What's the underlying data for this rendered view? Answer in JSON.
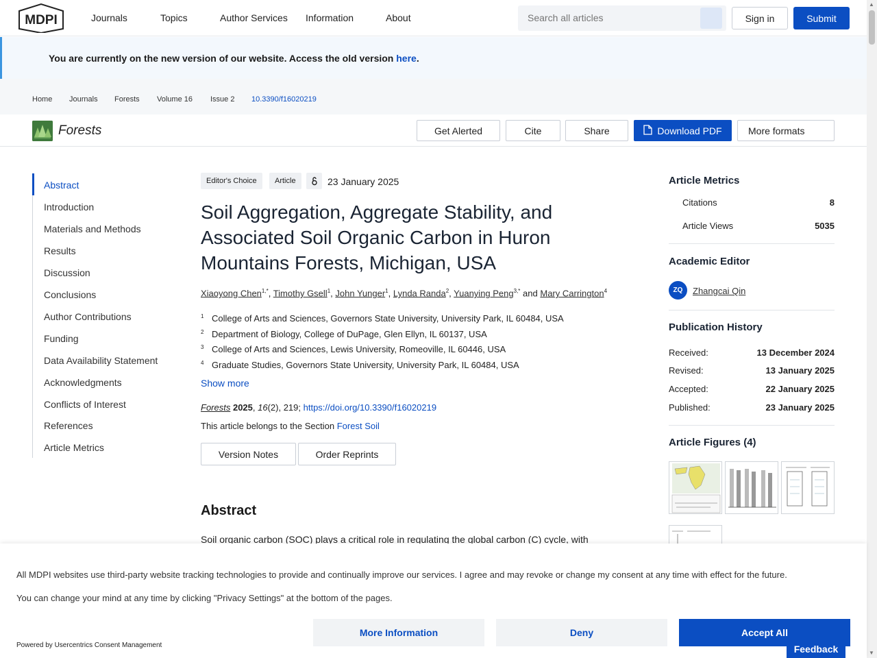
{
  "nav": {
    "logo_text": "MDPI",
    "items": [
      "Journals",
      "Topics",
      "Author Services",
      "Information",
      "About"
    ],
    "search_placeholder": "Search all articles",
    "signin": "Sign in",
    "submit": "Submit"
  },
  "banner": {
    "text": "You are currently on the new version of our website. Access the old version ",
    "link": "here",
    "tail": "."
  },
  "breadcrumb": [
    "Home",
    "Journals",
    "Forests",
    "Volume 16",
    "Issue 2",
    "10.3390/f16020219"
  ],
  "journal_bar": {
    "name": "Forests",
    "get_alerted": "Get Alerted",
    "cite": "Cite",
    "share": "Share",
    "download_pdf": "Download PDF",
    "more_formats": "More formats"
  },
  "toc": [
    "Abstract",
    "Introduction",
    "Materials and Methods",
    "Results",
    "Discussion",
    "Conclusions",
    "Author Contributions",
    "Funding",
    "Data Availability Statement",
    "Acknowledgments",
    "Conflicts of Interest",
    "References",
    "Article Metrics"
  ],
  "article": {
    "badges": [
      "Editor's Choice",
      "Article"
    ],
    "date": "23 January 2025",
    "title": "Soil Aggregation, Aggregate Stability, and Associated Soil Organic Carbon in Huron Mountains Forests, Michigan, USA",
    "authors": [
      {
        "name": "Xiaoyong Chen",
        "sup": "1,*"
      },
      {
        "name": "Timothy Gsell",
        "sup": "1"
      },
      {
        "name": "John Yunger",
        "sup": "1"
      },
      {
        "name": "Lynda Randa",
        "sup": "2"
      },
      {
        "name": "Yuanying Peng",
        "sup": "3,*"
      },
      {
        "name": "Mary Carrington",
        "sup": "4"
      }
    ],
    "and_word": "and",
    "affiliations": [
      {
        "num": "1",
        "text": "College of Arts and Sciences, Governors State University, University Park, IL 60484, USA"
      },
      {
        "num": "2",
        "text": "Department of Biology, College of DuPage, Glen Ellyn, IL 60137, USA"
      },
      {
        "num": "3",
        "text": "College of Arts and Sciences, Lewis University, Romeoville, IL 60446, USA"
      },
      {
        "num": "4",
        "text": "Graduate Studies, Governors State University, University Park, IL 60484, USA"
      }
    ],
    "show_more": "Show more",
    "citation": {
      "journal": "Forests",
      "year": "2025",
      "volume": "16",
      "issue_pages": "(2), 219; ",
      "doi": "https://doi.org/10.3390/f16020219"
    },
    "section_prefix": "This article belongs to the Section ",
    "section": "Forest Soil",
    "version_notes": "Version Notes",
    "order_reprints": "Order Reprints",
    "abstract_heading": "Abstract",
    "abstract_start": "Soil organic carbon (SOC) plays a critical role in regulating the global carbon (C) cycle, with"
  },
  "sidebar": {
    "metrics_heading": "Article Metrics",
    "citations_label": "Citations",
    "citations": "8",
    "views_label": "Article Views",
    "views": "5035",
    "editor_heading": "Academic Editor",
    "editor_initials": "ZQ",
    "editor_name": "Zhangcai Qin",
    "history_heading": "Publication History",
    "history": [
      {
        "label": "Received:",
        "date": "13 December 2024"
      },
      {
        "label": "Revised:",
        "date": "13 January 2025"
      },
      {
        "label": "Accepted:",
        "date": "22 January 2025"
      },
      {
        "label": "Published:",
        "date": "23 January 2025"
      }
    ],
    "figures_heading": "Article Figures (4)"
  },
  "consent": {
    "line1": "All MDPI websites use third-party website tracking technologies to provide and continually improve our services. I agree and may revoke or change my consent at any time with effect for the future.",
    "line2": "You can change your mind at any time by clicking \"Privacy Settings\" at the bottom of the pages.",
    "powered": "Powered by Usercentrics Consent Management",
    "more_info": "More Information",
    "deny": "Deny",
    "accept": "Accept All"
  },
  "feedback": "Feedback",
  "colors": {
    "accent": "#0b4ec2",
    "banner_bg": "#f3f8fd",
    "banner_border": "#3b95e0",
    "journal_green": "#3f7a3c"
  }
}
